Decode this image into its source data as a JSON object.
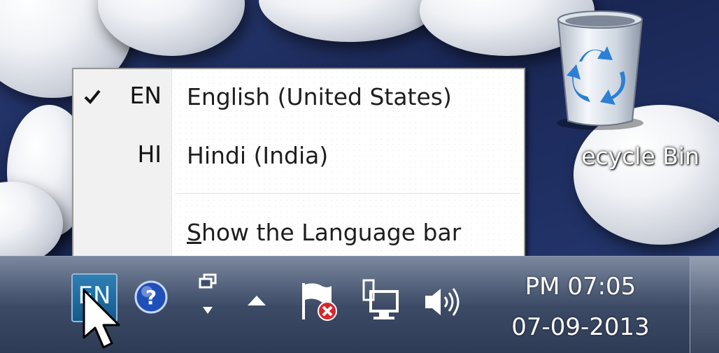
{
  "desktop": {
    "icons": [
      {
        "label": "ecycle Bin",
        "icon": "recycle-bin-icon"
      }
    ]
  },
  "language_menu": {
    "items": [
      {
        "code": "EN",
        "name": "English (United States)",
        "checked": true
      },
      {
        "code": "HI",
        "name": "Hindi (India)",
        "checked": false
      }
    ],
    "show_language_bar": {
      "accel": "S",
      "rest": "how the Language bar"
    }
  },
  "taskbar": {
    "language_indicator": "EN",
    "tray_icons": [
      "help-icon",
      "window-switch-icon",
      "show-hidden-icons-arrow",
      "action-center-flag-icon",
      "network-icon",
      "volume-icon"
    ],
    "clock": {
      "time": "PM 07:05",
      "date": "07-09-2013"
    }
  },
  "colors": {
    "taskbar": "#3f4e6a",
    "menu_background": "#ffffff",
    "menu_border": "#979797",
    "language_indicator": "#1b6da3"
  }
}
